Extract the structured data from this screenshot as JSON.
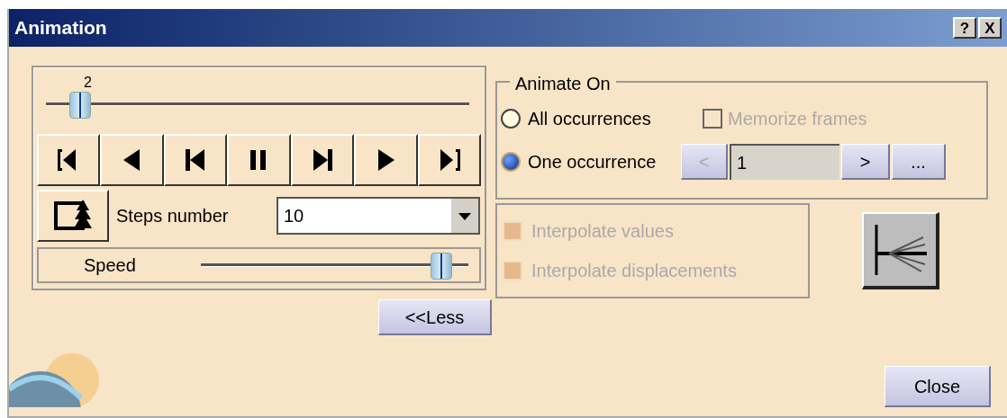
{
  "window": {
    "title": "Animation",
    "help": "?",
    "close": "X"
  },
  "frame_slider": {
    "reading": "2",
    "level": 0.08
  },
  "steps": {
    "label": "Steps number",
    "value": "10"
  },
  "speed": {
    "label": "Speed",
    "level": 0.9
  },
  "less_button": "<<Less",
  "animate_on": {
    "title": "Animate On",
    "options": [
      {
        "label": "All occurrences",
        "selected": false
      },
      {
        "label": "One occurrence",
        "selected": true
      }
    ],
    "memorize": {
      "label": "Memorize frames",
      "checked": false,
      "disabled": true
    },
    "occurrence": {
      "prev": "<",
      "prev_disabled": true,
      "value": "1",
      "next": ">",
      "more": "..."
    }
  },
  "interpolate": [
    {
      "label": "Interpolate values",
      "checked": false,
      "disabled": true
    },
    {
      "label": "Interpolate displacements",
      "checked": false,
      "disabled": true
    }
  ],
  "close_button": "Close"
}
